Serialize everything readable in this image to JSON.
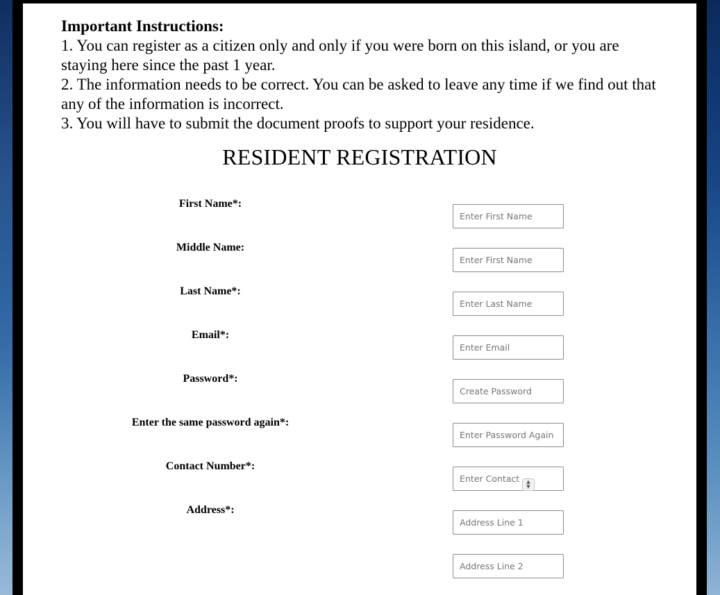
{
  "instructions": {
    "heading": "Important Instructions:",
    "lines": [
      "1. You can register as a citizen only and only if you were born on this island, or you are staying here since the past 1 year.",
      "2. The information needs to be correct. You can be asked to leave any time if we find out that any of the information is incorrect.",
      "3. You will have to submit the document proofs to support your residence."
    ]
  },
  "form": {
    "title": "RESIDENT REGISTRATION",
    "fields": [
      {
        "label": "First Name*:",
        "placeholder": "Enter First Name"
      },
      {
        "label": "Middle Name:",
        "placeholder": "Enter First Name"
      },
      {
        "label": "Last Name*:",
        "placeholder": "Enter Last Name"
      },
      {
        "label": "Email*:",
        "placeholder": "Enter Email"
      },
      {
        "label": "Password*:",
        "placeholder": "Create Password"
      },
      {
        "label": "Enter the same password again*:",
        "placeholder": "Enter Password Again"
      },
      {
        "label": "Contact Number*:",
        "placeholder": "Enter Contact"
      },
      {
        "label": "Address*:",
        "placeholder": "Address Line 1"
      },
      {
        "label": "",
        "placeholder": "Address Line 2"
      }
    ]
  },
  "icons": {
    "spinner": "number-spinner-icon"
  },
  "colors": {
    "background": "#1d5192",
    "frame": "#000000",
    "panel": "#ffffff",
    "input_border": "#8a8a8a"
  }
}
